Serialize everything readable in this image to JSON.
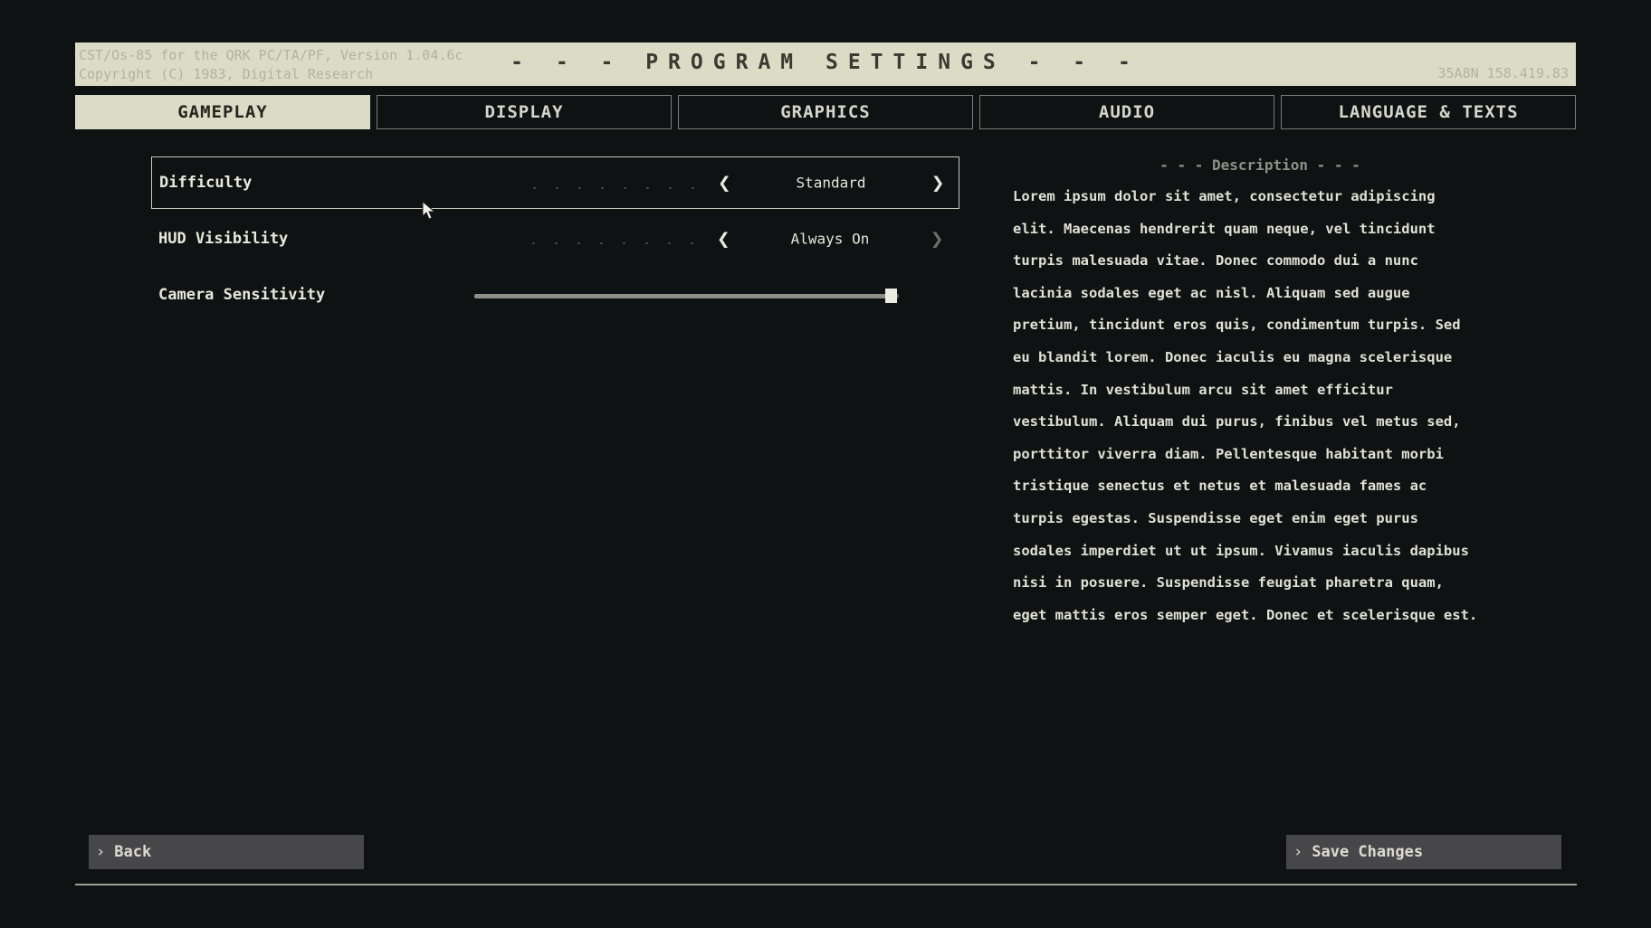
{
  "header": {
    "info_line1": "CST/Os-85 for the QRK PC/TA/PF, Version 1.04.6c",
    "info_line2": "Copyright (C) 1983, Digital Research",
    "title": "- - - PROGRAM SETTINGS - - -",
    "right_code": "35A8N 158.419.83"
  },
  "tabs": [
    {
      "label": "GAMEPLAY",
      "active": true
    },
    {
      "label": "DISPLAY",
      "active": false
    },
    {
      "label": "GRAPHICS",
      "active": false
    },
    {
      "label": "AUDIO",
      "active": false
    },
    {
      "label": "LANGUAGE & TEXTS",
      "active": false
    }
  ],
  "settings": {
    "difficulty": {
      "label": "Difficulty",
      "value": "Standard",
      "prev_icon": "chevron-left-icon",
      "next_icon": "chevron-right-icon"
    },
    "hud": {
      "label": "HUD Visibility",
      "value": "Always On",
      "prev_icon": "chevron-left-icon",
      "next_icon": "chevron-right-icon"
    },
    "camera": {
      "label": "Camera Sensitivity",
      "value_fraction": 0.98
    }
  },
  "description": {
    "title": "- - - Description - - -",
    "text": "Lorem ipsum dolor sit amet, consectetur adipiscing elit. Maecenas hendrerit quam neque, vel tincidunt turpis malesuada vitae. Donec commodo dui a nunc lacinia sodales eget ac nisl. Aliquam sed augue pretium, tincidunt eros quis, condimentum turpis. Sed eu blandit lorem. Donec iaculis eu magna scelerisque mattis. In vestibulum arcu sit amet efficitur vestibulum. Aliquam dui purus, finibus vel metus sed, porttitor viverra diam. Pellentesque habitant morbi tristique senectus et netus et malesuada fames ac turpis egestas. Suspendisse eget enim eget purus sodales imperdiet ut ut ipsum. Vivamus iaculis dapibus nisi in posuere. Suspendisse feugiat pharetra quam, eget mattis eros semper eget. Donec et scelerisque est."
  },
  "footer": {
    "back_label": "Back",
    "save_label": "Save Changes",
    "chevron": "›"
  },
  "chevrons": {
    "left": "❮",
    "right": "❯"
  }
}
